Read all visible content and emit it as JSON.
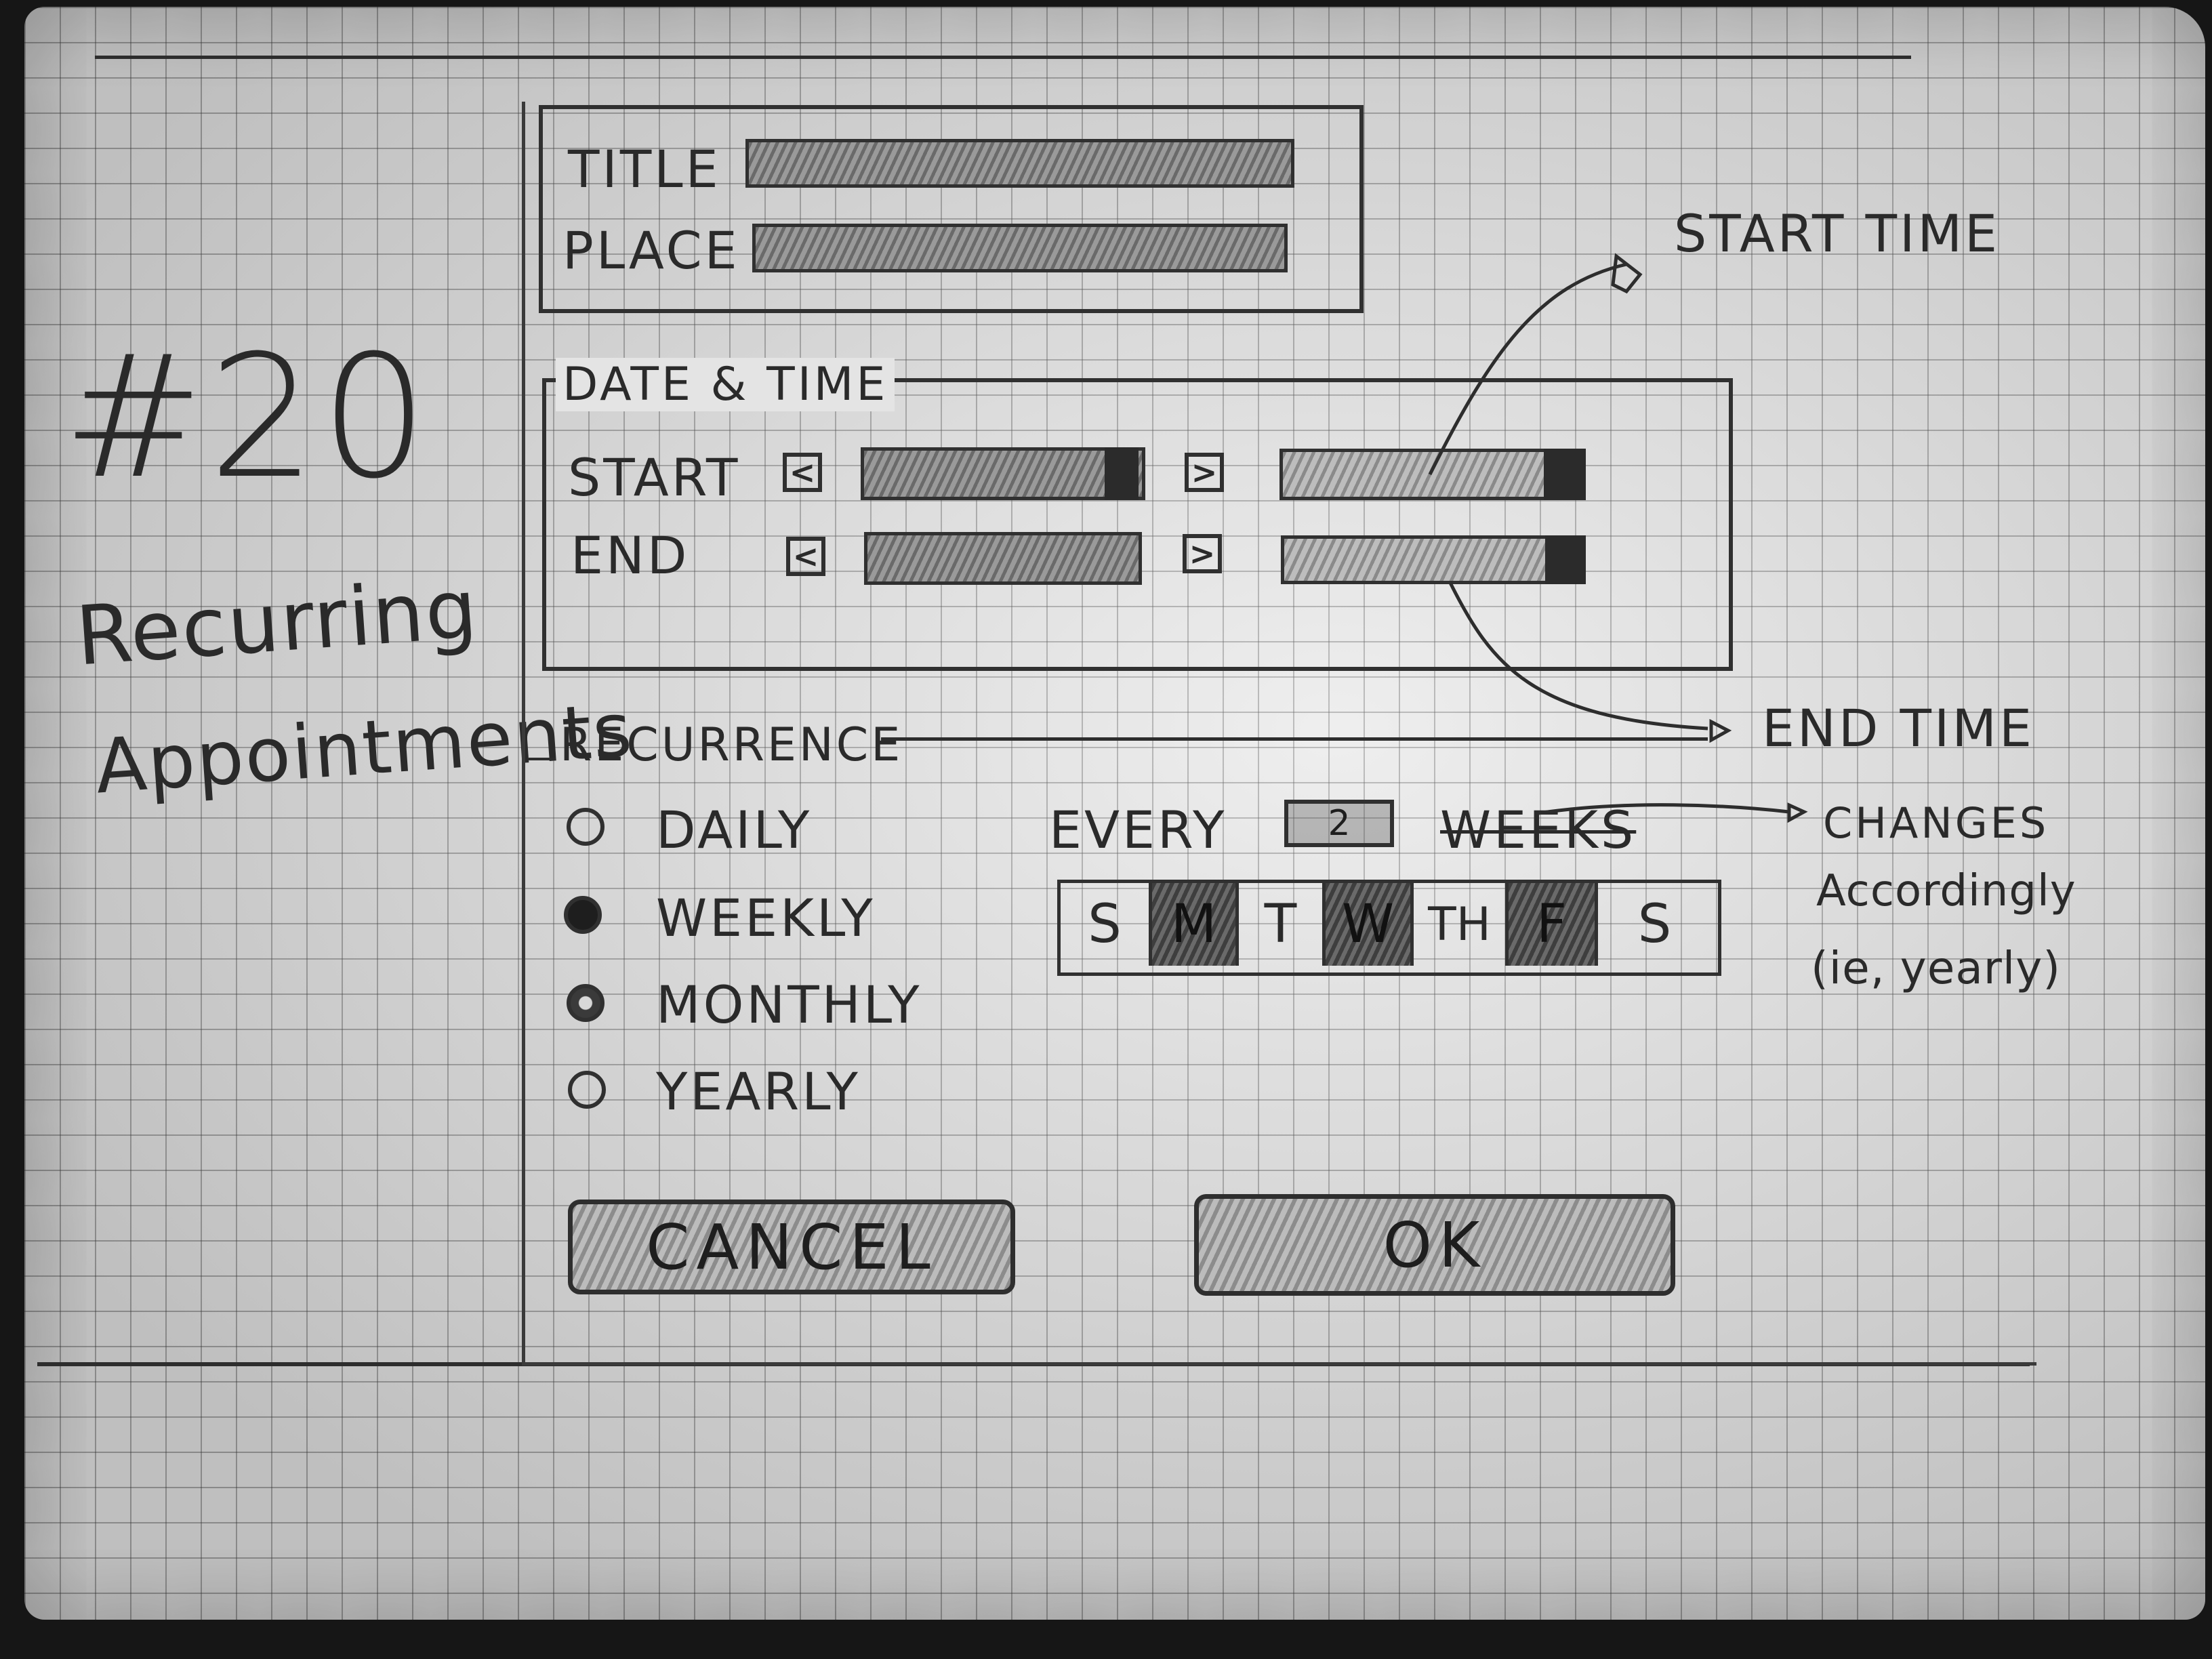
{
  "sketch": {
    "number": "#20",
    "name_line1": "Recurring",
    "name_line2": "Appointments"
  },
  "details": {
    "title_label": "TITLE",
    "place_label": "PLACE"
  },
  "datetime": {
    "legend": "DATE & TIME",
    "start_label": "START",
    "end_label": "END",
    "prev_glyph": "<",
    "next_glyph": ">"
  },
  "recurrence": {
    "legend": "RECURRENCE",
    "options": [
      {
        "label": "DAILY",
        "state": "empty"
      },
      {
        "label": "WEEKLY",
        "state": "selected"
      },
      {
        "label": "MONTHLY",
        "state": "empty"
      },
      {
        "label": "YEARLY",
        "state": "empty"
      }
    ],
    "every_label": "EVERY",
    "every_value": "2",
    "unit_label": "WEEKS",
    "days": [
      {
        "label": "S",
        "selected": false
      },
      {
        "label": "M",
        "selected": true
      },
      {
        "label": "T",
        "selected": false
      },
      {
        "label": "W",
        "selected": true
      },
      {
        "label": "TH",
        "selected": false
      },
      {
        "label": "F",
        "selected": true
      },
      {
        "label": "S",
        "selected": false
      }
    ]
  },
  "actions": {
    "cancel_label": "CANCEL",
    "ok_label": "OK"
  },
  "annotations": {
    "start_time": "START TIME",
    "end_time": "END TIME",
    "changes_line1": "CHANGES",
    "changes_line2": "Accordingly",
    "changes_line3": "(ie, yearly)"
  }
}
